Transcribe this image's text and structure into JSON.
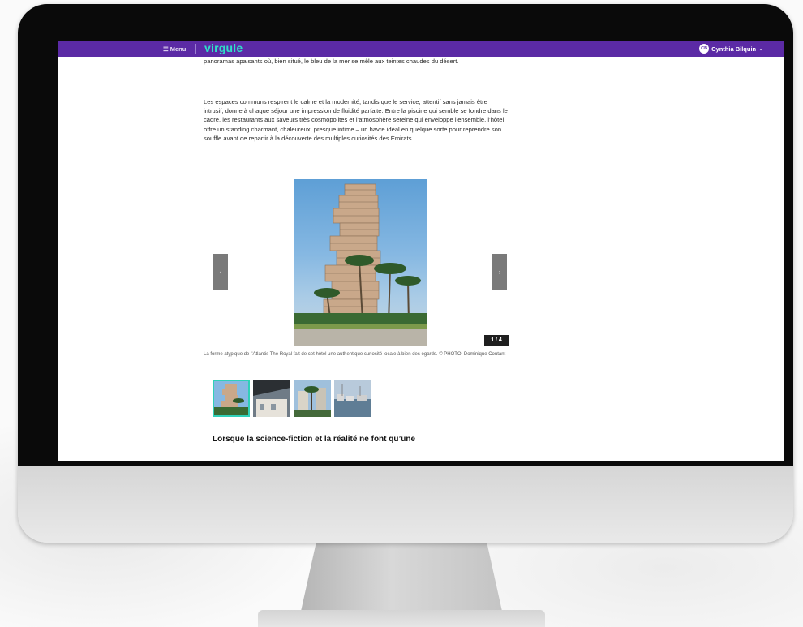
{
  "header": {
    "menu_label": "Menu",
    "logo_text": "virgule",
    "user_initials": "CB",
    "user_name": "Cynthia Bilquin"
  },
  "article": {
    "paragraph_1": "panoramas apaisants où, bien situé, le bleu de la mer se mêle aux teintes chaudes du désert.",
    "paragraph_2": "Les espaces communs respirent le calme et la modernité, tandis que le service, attentif sans jamais être intrusif, donne à chaque séjour une impression de fluidité parfaite. Entre la piscine qui semble se fondre dans le cadre, les restaurants aux saveurs très cosmopolites et l’atmosphère sereine qui enveloppe l’ensemble, l’hôtel offre un standing charmant, chaleureux, presque intime – un havre idéal en quelque sorte pour reprendre son souffle avant de repartir à la découverte des multiples curiosités des Émirats.",
    "subheading": "Lorsque la science-fiction et la réalité ne font qu’une"
  },
  "gallery": {
    "counter": "1 / 4",
    "prev_glyph": "‹",
    "next_glyph": "›",
    "caption": "La forme atypique de l'Atlantis The Royal fait de cet hôtel une authentique curiosité locale à bien des égards. © PHOTO: Dominique Coutant",
    "thumbnails": [
      "hotel-tower",
      "white-building",
      "palm-trees",
      "marina"
    ],
    "active_index": 1
  },
  "colors": {
    "topbar": "#5b2aa5",
    "logo": "#2fe0c8",
    "thumb_active_border": "#30d0b8"
  }
}
